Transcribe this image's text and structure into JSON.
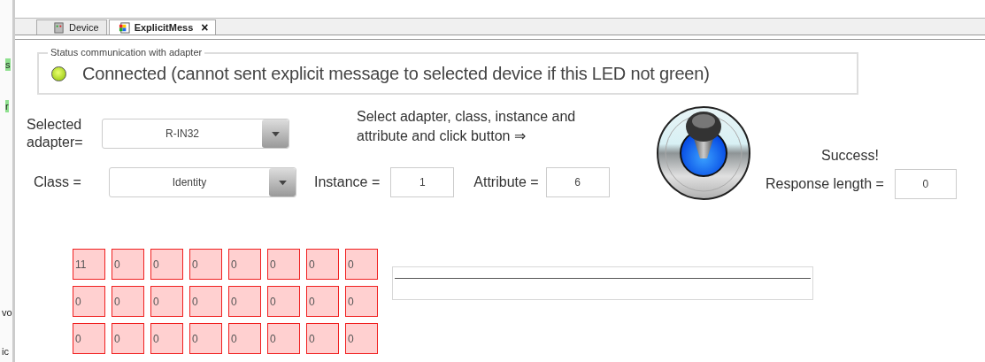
{
  "side_fragments": [
    {
      "text": "s",
      "highlighted": true
    },
    {
      "text": "r",
      "highlighted": true
    },
    {
      "text": "vo",
      "highlighted": false
    },
    {
      "text": "ic",
      "highlighted": false
    }
  ],
  "tabs": [
    {
      "label": "Device",
      "selected": false
    },
    {
      "label": "ExplicitMess",
      "selected": true,
      "close": "×"
    }
  ],
  "status": {
    "title": "Status communication with adapter",
    "connected": true,
    "message": "Connected (cannot sent explicit message to selected device if this LED not green)"
  },
  "adapter": {
    "label": "Selected adapter=",
    "value": "R-IN32"
  },
  "class": {
    "label": "Class =",
    "value": "Identity"
  },
  "instruction": "Select adapter, class, instance and attribute and click button ⇒",
  "instance": {
    "label": "Instance =",
    "value": "1"
  },
  "attribute": {
    "label": "Attribute =",
    "value": "6"
  },
  "result": "Success!",
  "response_length": {
    "label": "Response length =",
    "value": "0"
  },
  "data_cells": [
    [
      "11",
      "0",
      "0",
      "0",
      "0",
      "0",
      "0",
      "0"
    ],
    [
      "0",
      "0",
      "0",
      "0",
      "0",
      "0",
      "0",
      "0"
    ],
    [
      "0",
      "0",
      "0",
      "0",
      "0",
      "0",
      "0",
      "0"
    ]
  ]
}
